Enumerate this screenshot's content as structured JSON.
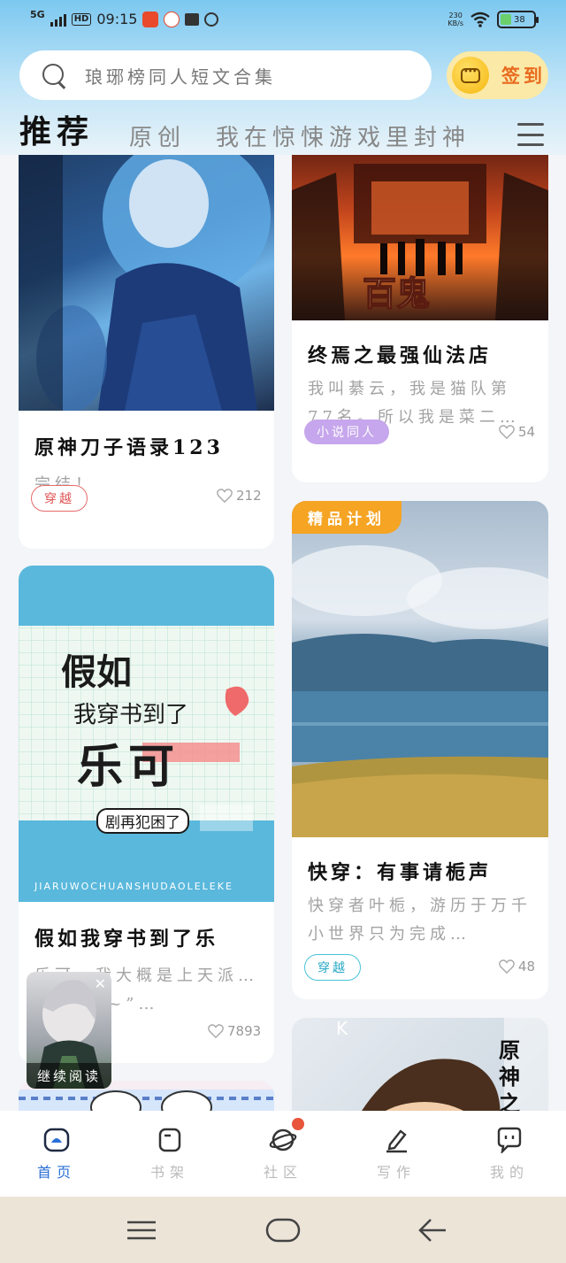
{
  "status_bar": {
    "network": "5G",
    "hd": "HD",
    "time": "09:15",
    "net_speed_value": "230",
    "net_speed_unit": "KB/s",
    "battery": "38"
  },
  "search": {
    "placeholder": "琅琊榜同人短文合集"
  },
  "signin": {
    "label": "签到"
  },
  "tabs": [
    {
      "label": "推荐",
      "active": true
    },
    {
      "label": "原创",
      "active": false
    },
    {
      "label": "我在惊悚游戏里封神",
      "active": false
    }
  ],
  "cards": [
    {
      "title": "原神刀子语录123",
      "desc": "完结！",
      "tag": "穿越",
      "likes": "212"
    },
    {
      "title": "终焉之最强仙法店",
      "desc": "我叫綦云，我是猫队第77名。所以我是菜二…",
      "tag": "小说同人",
      "likes": "54"
    },
    {
      "title": "假如我穿书到了乐",
      "desc": "乐可，我大概是上天派…来的“哥~”…",
      "tag": "",
      "likes": "7893",
      "cover_title": "假如",
      "cover_line2": "我穿书到了",
      "cover_name": "乐可",
      "cover_sub": "剧再犯困了",
      "cover_pinyin": "JIARUWOCHUANSHUDAOLELEKE"
    },
    {
      "title": "快穿：有事请栀声",
      "desc": "快穿者叶栀，游历于万千小世界只为完成…",
      "tag": "穿越",
      "likes": "48",
      "badge": "精品计划"
    },
    {
      "title": "原神之",
      "cover_letter": "K"
    }
  ],
  "floating_widget": {
    "label": "继续阅读",
    "close": "✕"
  },
  "bottom_nav": [
    {
      "label": "首页",
      "icon": "home-icon",
      "active": true
    },
    {
      "label": "书架",
      "icon": "bookshelf-icon",
      "active": false
    },
    {
      "label": "社区",
      "icon": "planet-icon",
      "active": false,
      "dot": true
    },
    {
      "label": "写作",
      "icon": "pen-icon",
      "active": false
    },
    {
      "label": "我的",
      "icon": "chat-icon",
      "active": false
    }
  ],
  "colors": {
    "accent": "#2a6fd6",
    "signin": "#e86b1f",
    "premium": "#f5a423"
  }
}
